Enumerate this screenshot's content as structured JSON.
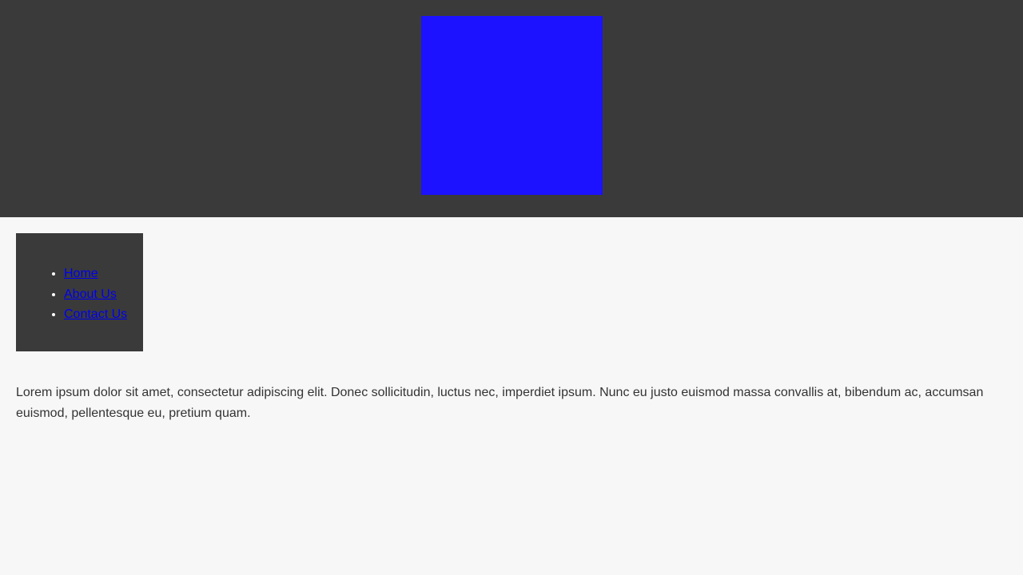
{
  "header": {
    "logo_color": "#1c12ff",
    "background": "#3a3a3a"
  },
  "nav": {
    "items": [
      {
        "label": "Home"
      },
      {
        "label": "About Us"
      },
      {
        "label": "Contact Us"
      }
    ]
  },
  "main": {
    "paragraph": "Lorem ipsum dolor sit amet, consectetur adipiscing elit. Donec sollicitudin, luctus nec, imperdiet ipsum. Nunc eu justo euismod massa convallis at, bibendum ac, accumsan euismod, pellentesque eu, pretium quam."
  }
}
